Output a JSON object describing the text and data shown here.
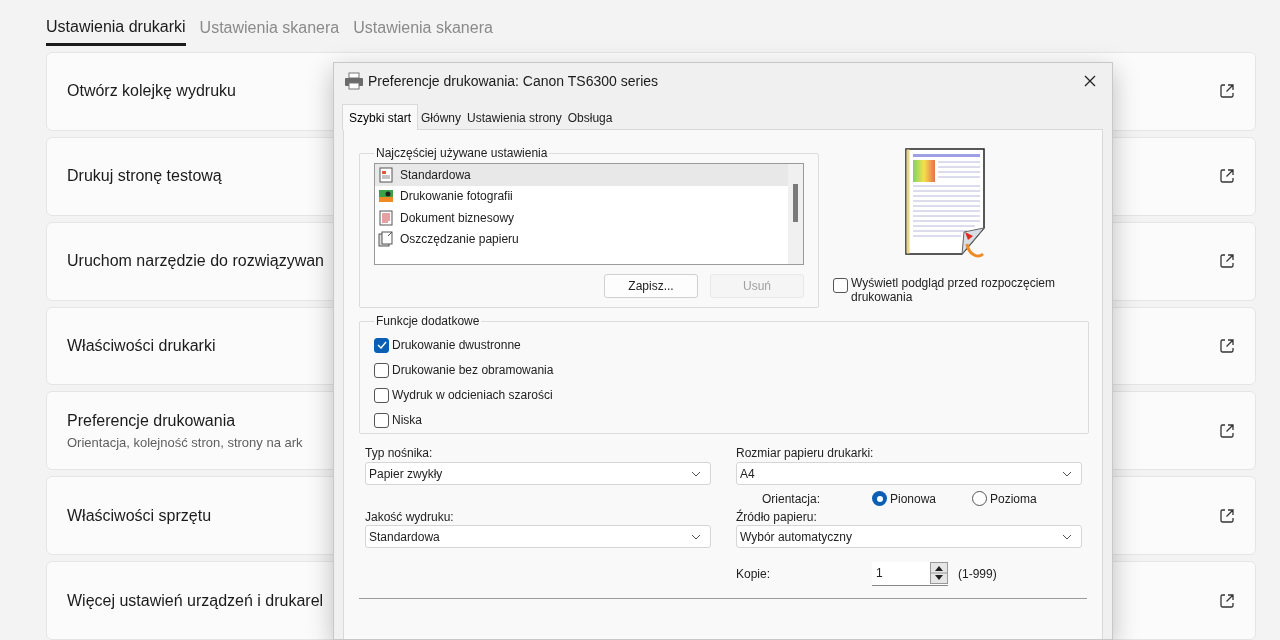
{
  "settings_tabs": [
    {
      "label": "Ustawienia drukarki",
      "selected": true
    },
    {
      "label": "Ustawienia skanera",
      "selected": false
    },
    {
      "label": "Ustawienia skanera",
      "selected": false
    }
  ],
  "settings_items": [
    {
      "title": "Otwórz kolejkę wydruku"
    },
    {
      "title": "Drukuj stronę testową"
    },
    {
      "title": "Uruchom narzędzie do rozwiązywan"
    },
    {
      "title": "Właściwości drukarki"
    },
    {
      "title": "Preferencje drukowania",
      "subtitle": "Orientacja, kolejność stron, strony na ark"
    },
    {
      "title": "Właściwości sprzętu"
    },
    {
      "title": "Więcej ustawień urządzeń i drukarel"
    }
  ],
  "dialog": {
    "title": "Preferencje drukowania: Canon TS6300 series",
    "tabs": [
      {
        "label": "Szybki start",
        "selected": true
      },
      {
        "label": "Główny",
        "selected": false
      },
      {
        "label": "Ustawienia strony",
        "selected": false
      },
      {
        "label": "Obsługa",
        "selected": false
      }
    ],
    "presets_group": {
      "title": "Najczęściej używane ustawienia",
      "items": [
        {
          "label": "Standardowa",
          "selected": true
        },
        {
          "label": "Drukowanie fotografii",
          "selected": false
        },
        {
          "label": "Dokument biznesowy",
          "selected": false
        },
        {
          "label": "Oszczędzanie papieru",
          "selected": false
        }
      ],
      "buttons": [
        {
          "label": "Zapisz...",
          "disabled": false
        },
        {
          "label": "Usuń",
          "disabled": true
        }
      ]
    },
    "preview_checkbox": {
      "label": "Wyświetl podgląd przed rozpoczęciem drukowania",
      "checked": false
    },
    "features_group": {
      "title": "Funkcje dodatkowe",
      "options": [
        {
          "label": "Drukowanie dwustronne",
          "checked": true
        },
        {
          "label": "Drukowanie bez obramowania",
          "checked": false
        },
        {
          "label": "Wydruk w odcieniach szarości",
          "checked": false
        },
        {
          "label": "Niska",
          "checked": false
        }
      ]
    },
    "media_type": {
      "label": "Typ nośnika:",
      "value": "Papier zwykły"
    },
    "paper_size": {
      "label": "Rozmiar papieru drukarki:",
      "value": "A4"
    },
    "orientation": {
      "label": "Orientacja:",
      "options": [
        {
          "label": "Pionowa",
          "selected": true
        },
        {
          "label": "Pozioma",
          "selected": false
        }
      ]
    },
    "print_quality": {
      "label": "Jakość wydruku:",
      "value": "Standardowa"
    },
    "paper_source": {
      "label": "Źródło papieru:",
      "value": "Wybór automatyczny"
    },
    "copies": {
      "label": "Kopie:",
      "value": "1",
      "range": "(1-999)"
    }
  }
}
